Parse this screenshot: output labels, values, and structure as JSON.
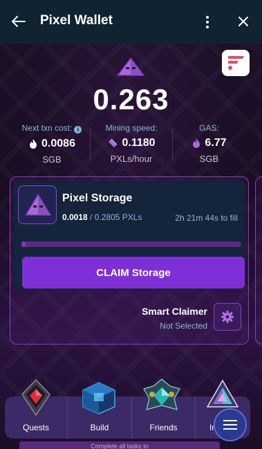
{
  "header": {
    "title": "Pixel Wallet"
  },
  "wallet": {
    "balance": "0.263"
  },
  "stats": [
    {
      "label": "Next txn cost:",
      "value": "0.0086",
      "unit": "SGB",
      "icon": "fire-icon"
    },
    {
      "label": "Mining speed:",
      "value": "0.1180",
      "unit": "PXLs/hour",
      "icon": "gem-icon"
    },
    {
      "label": "GAS:",
      "value": "6.77",
      "unit": "SGB",
      "icon": "flame-icon"
    }
  ],
  "storage": {
    "title": "Pixel Storage",
    "current": "0.0018",
    "max": "/ 0.2805 PXLs",
    "fill_time": "2h 21m 44s to fill",
    "progress": 0.0064,
    "claim_label": "CLAIM Storage",
    "smart_label": "Smart Claimer",
    "smart_status": "Not Selected"
  },
  "nav": [
    {
      "label": "Quests",
      "icon": "red-gem-emblem-icon"
    },
    {
      "label": "Build",
      "icon": "blue-cube-emblem-icon"
    },
    {
      "label": "Friends",
      "icon": "teal-gem-emblem-icon"
    },
    {
      "label": "In",
      "icon": "rainbow-gem-emblem-icon"
    }
  ],
  "bottom_strip_text": "Complete all tasks to",
  "colors": {
    "accent": "#7f2fd6",
    "header": "#0f2430",
    "muted": "#8ab8d8"
  }
}
